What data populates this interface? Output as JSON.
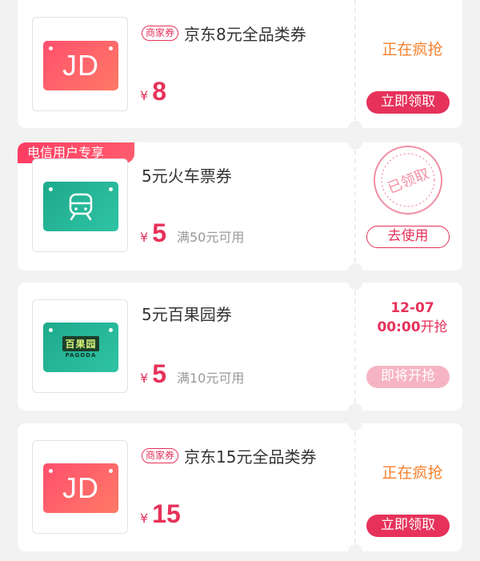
{
  "colors": {
    "accent": "#e6325a",
    "orange_status": "#f6822f",
    "jd_gradient": [
      "#ff4f6e",
      "#ff7a66"
    ],
    "green_gradient": [
      "#1eaa8c",
      "#2fc3a4"
    ]
  },
  "coupons": [
    {
      "logo_text": "JD",
      "tag": "商家券",
      "title": "京东8元全品类券",
      "currency": "¥",
      "amount": "8",
      "condition": "",
      "status": "正在疯抢",
      "button": "立即领取"
    },
    {
      "badge": "电信用户专享",
      "icon": "train-icon",
      "title": "5元火车票券",
      "currency": "¥",
      "amount": "5",
      "condition": "满50元可用",
      "stamp": "已领取",
      "button": "去使用"
    },
    {
      "logo_cn": "百果园",
      "logo_en": "PAGODA",
      "title": "5元百果园券",
      "currency": "¥",
      "amount": "5",
      "condition": "满10元可用",
      "date": "12-07",
      "time": "00:00",
      "time_suffix": "开抢",
      "button": "即将开抢"
    },
    {
      "logo_text": "JD",
      "tag": "商家券",
      "title": "京东15元全品类券",
      "currency": "¥",
      "amount": "15",
      "condition": "",
      "status": "正在疯抢",
      "button": "立即领取"
    }
  ]
}
